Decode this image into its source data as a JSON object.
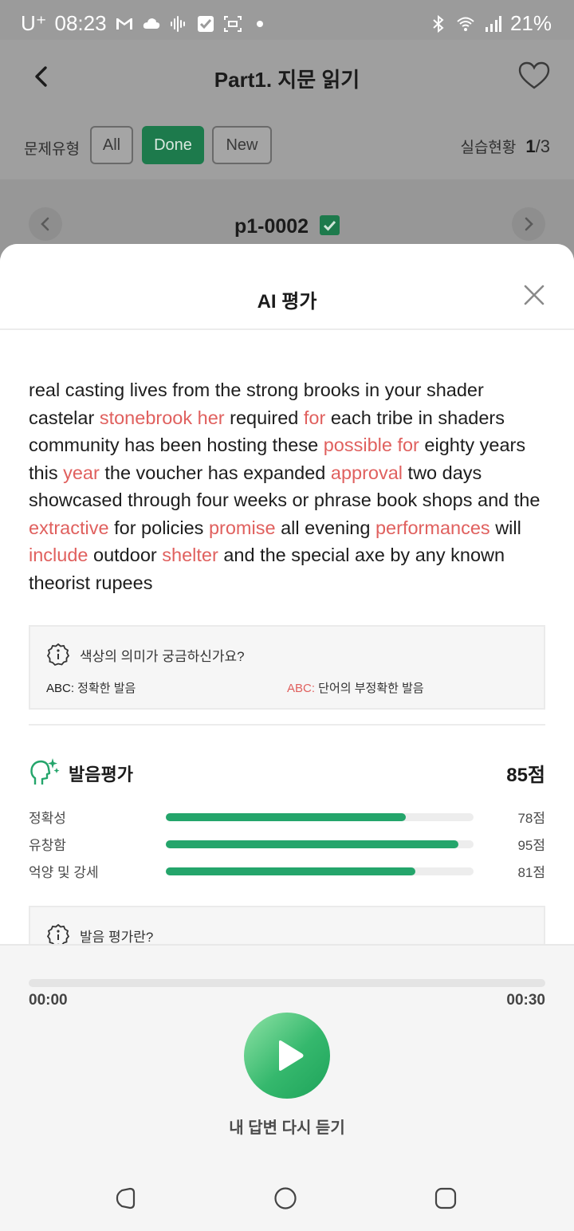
{
  "status_bar": {
    "carrier": "U⁺",
    "time": "08:23",
    "battery": "21%",
    "icons": [
      "gmail-icon",
      "cloud-icon",
      "audio-icon",
      "check-icon",
      "screen-record-icon",
      "dot-icon",
      "bluetooth-icon",
      "wifi-icon",
      "signal-icon"
    ]
  },
  "header": {
    "title": "Part1. 지문 읽기",
    "back_icon": "chevron-left-icon",
    "favorite_icon": "heart-icon"
  },
  "filter": {
    "label": "문제유형",
    "chips": [
      {
        "label": "All",
        "active": false
      },
      {
        "label": "Done",
        "active": true
      },
      {
        "label": "New",
        "active": false
      }
    ],
    "progress_label": "실습현황",
    "progress_current": "1",
    "progress_total": "/3"
  },
  "item_nav": {
    "id": "p1-0002",
    "completed": true
  },
  "sheet": {
    "title": "AI 평가",
    "close_icon": "close-icon",
    "passage_segments": [
      {
        "text": "real casting lives from the strong brooks in your shader castelar ",
        "err": false
      },
      {
        "text": "stonebrook her",
        "err": true
      },
      {
        "text": " required ",
        "err": false
      },
      {
        "text": "for",
        "err": true
      },
      {
        "text": " each tribe in shaders community has been hosting these ",
        "err": false
      },
      {
        "text": "possible for",
        "err": true
      },
      {
        "text": " eighty years this ",
        "err": false
      },
      {
        "text": "year",
        "err": true
      },
      {
        "text": " the voucher has expanded ",
        "err": false
      },
      {
        "text": "approval",
        "err": true
      },
      {
        "text": " two days showcased through four weeks or phrase book shops and the ",
        "err": false
      },
      {
        "text": "extractive",
        "err": true
      },
      {
        "text": " for policies ",
        "err": false
      },
      {
        "text": "promise",
        "err": true
      },
      {
        "text": " all evening ",
        "err": false
      },
      {
        "text": "performances",
        "err": true
      },
      {
        "text": " will ",
        "err": false
      },
      {
        "text": "include",
        "err": true
      },
      {
        "text": " outdoor ",
        "err": false
      },
      {
        "text": "shelter",
        "err": true
      },
      {
        "text": " and the special axe by any known theorist rupees",
        "err": false
      }
    ],
    "legend": {
      "question": "색상의 의미가 궁금하신가요?",
      "correct_abc": "ABC:",
      "correct_text": " 정확한 발음",
      "incorrect_abc": "ABC:",
      "incorrect_text": " 단어의 부정확한 발음"
    },
    "score": {
      "title": "발음평가",
      "total": "85점",
      "metrics": [
        {
          "label": "정확성",
          "value": "78점",
          "fraction": 0.78
        },
        {
          "label": "유창함",
          "value": "95점",
          "fraction": 0.95
        },
        {
          "label": "억양 및 강세",
          "value": "81점",
          "fraction": 0.81
        }
      ]
    },
    "info_question": "발음 평가란?"
  },
  "player": {
    "time_start": "00:00",
    "time_end": "00:30",
    "progress": 0,
    "play_icon": "play-icon",
    "replay_label": "내 답변 다시 듣기"
  },
  "colors": {
    "accent_green": "#24a56b",
    "error_red": "#e0605e",
    "chip_active": "#1d7a4c"
  }
}
